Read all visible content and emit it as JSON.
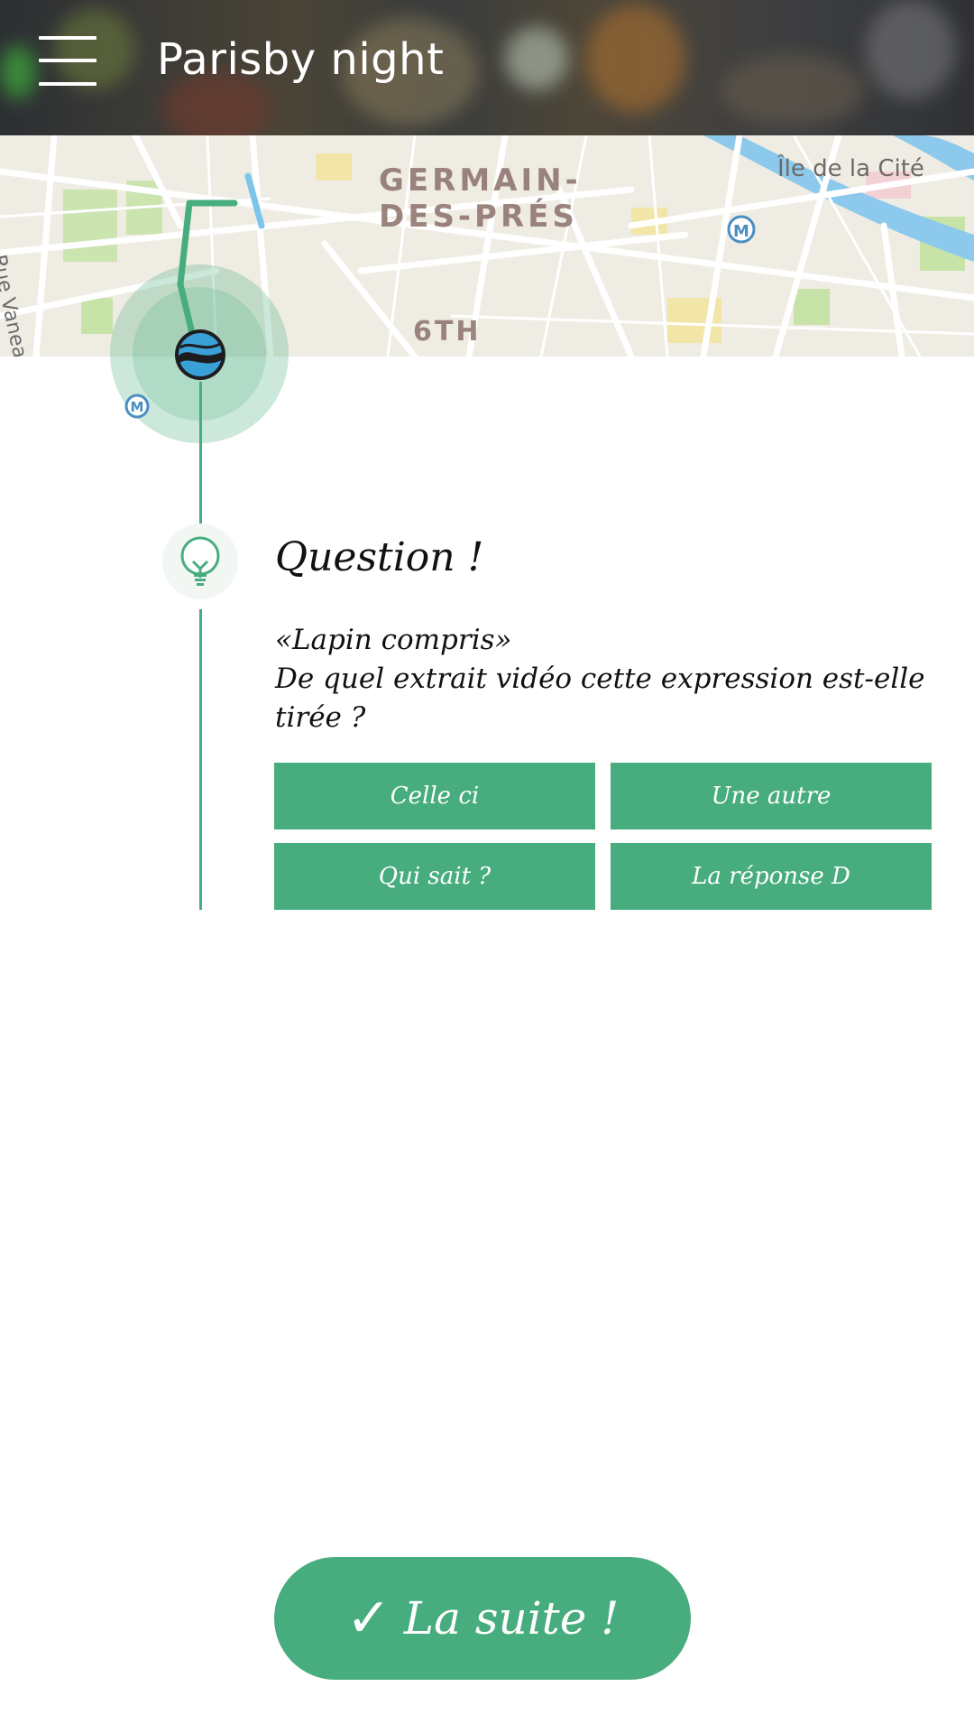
{
  "header": {
    "title": "Parisby night",
    "menu_icon": "hamburger-menu-icon"
  },
  "map": {
    "labels": {
      "neighborhood_line1": "GERMAIN-",
      "neighborhood_line2": "DES-PRÉS",
      "arrondissement": "6TH",
      "island": "Île de la Cité",
      "street": "Rue Vaneau"
    },
    "metro_icon": "metro-icon",
    "marker_icon": "app-logo-marker-icon"
  },
  "question": {
    "icon": "lightbulb-icon",
    "title": "Question !",
    "quote": "«Lapin compris»",
    "text_line1": "De quel extrait vidéo cette expression est-elle",
    "text_line2": "tirée ?",
    "answers": [
      {
        "label": "Celle ci"
      },
      {
        "label": "Une autre"
      },
      {
        "label": "Qui sait ?"
      },
      {
        "label": "La réponse D"
      }
    ]
  },
  "footer": {
    "next_icon": "checkmark-icon",
    "next_check": "✓",
    "next_label": "La suite !"
  },
  "colors": {
    "accent": "#48ad7e",
    "map_route": "#48ad7e",
    "water": "#7cc4ea"
  }
}
